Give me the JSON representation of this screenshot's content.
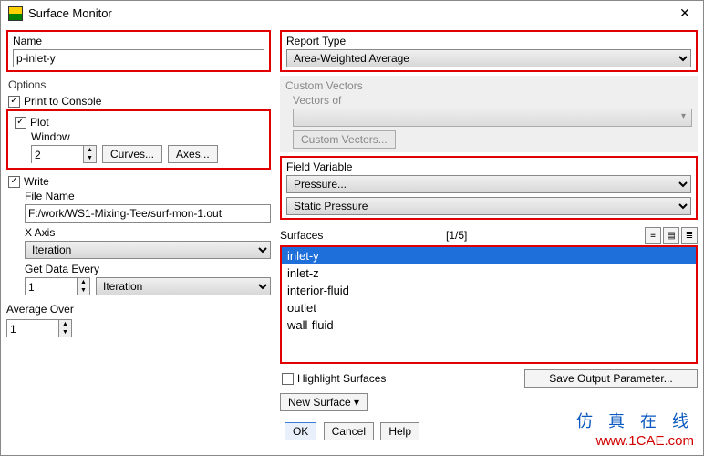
{
  "window": {
    "title": "Surface Monitor",
    "close": "✕"
  },
  "left": {
    "name_label": "Name",
    "name_value": "p-inlet-y",
    "options_label": "Options",
    "print_label": "Print to Console",
    "plot_label": "Plot",
    "window_label": "Window",
    "window_value": "2",
    "curves_btn": "Curves...",
    "axes_btn": "Axes...",
    "write_label": "Write",
    "filename_label": "File Name",
    "filename_value": "F:/work/WS1-Mixing-Tee/surf-mon-1.out",
    "xaxis_label": "X Axis",
    "xaxis_value": "Iteration",
    "getdata_label": "Get Data Every",
    "getdata_num": "1",
    "getdata_when": "Iteration",
    "avg_label": "Average Over",
    "avg_value": "1"
  },
  "right": {
    "report_label": "Report Type",
    "report_value": "Area-Weighted Average",
    "cv_label": "Custom Vectors",
    "cv_vectors_of": "Vectors of",
    "cv_btn": "Custom Vectors...",
    "fv_label": "Field Variable",
    "fv1": "Pressure...",
    "fv2": "Static Pressure",
    "surfaces_label": "Surfaces",
    "surfaces_count": "[1/5]",
    "items": [
      "inlet-y",
      "inlet-z",
      "interior-fluid",
      "outlet",
      "wall-fluid"
    ],
    "highlight_label": "Highlight Surfaces",
    "save_btn": "Save Output Parameter...",
    "new_surface": "New Surface"
  },
  "buttons": {
    "ok": "OK",
    "cancel": "Cancel",
    "help": "Help"
  },
  "wm": {
    "a": "仿 真 在 线",
    "b": "www.1CAE.com"
  }
}
